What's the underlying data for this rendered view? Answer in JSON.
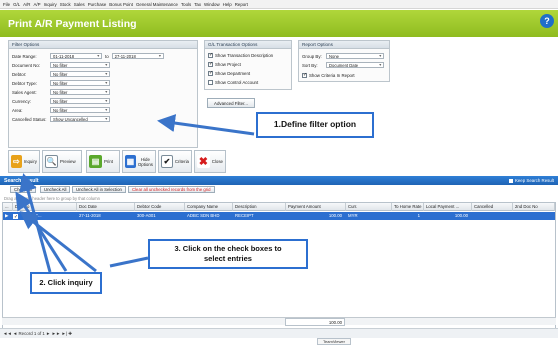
{
  "menubar": [
    "File",
    "G/L",
    "A/R",
    "A/P",
    "Inquiry",
    "Stock",
    "Sales",
    "Purchase",
    "Bonus Point",
    "General Maintenance",
    "Tools",
    "Tax",
    "Window",
    "Help",
    "Report"
  ],
  "page_title": "Print A/R Payment Listing",
  "help_icon": "?",
  "filter_options": {
    "title": "Filter Options",
    "date_range_label": "Date Range:",
    "date_from": "01-11-2018",
    "date_to_label": "to",
    "date_to": "27-11-2018",
    "rows": [
      {
        "label": "Document No:",
        "value": "No filter"
      },
      {
        "label": "Debtor:",
        "value": "No filter"
      },
      {
        "label": "Debtor Type:",
        "value": "No filter"
      },
      {
        "label": "Sales Agent:",
        "value": "No filter"
      },
      {
        "label": "Currency:",
        "value": "No filter"
      },
      {
        "label": "Area:",
        "value": "No filter"
      },
      {
        "label": "Cancelled Status:",
        "value": "Show Uncancelled"
      }
    ]
  },
  "gl_options": {
    "title": "G/L Transaction Options",
    "checks": [
      {
        "label": "Show Transaction Description",
        "checked": true
      },
      {
        "label": "Show Project",
        "checked": true
      },
      {
        "label": "Show Department",
        "checked": true
      },
      {
        "label": "Show Control Account",
        "checked": false
      }
    ],
    "advanced_filter": "Advanced Filter..."
  },
  "report_options": {
    "title": "Report Options",
    "group_by_label": "Group By:",
    "group_by": "None",
    "sort_by_label": "Sort By:",
    "sort_by": "Document Date",
    "show_criteria": "Show Criteria In Report",
    "show_criteria_checked": true
  },
  "toolbar": {
    "inquiry": "Inquiry",
    "preview": "Preview",
    "print": "Print",
    "hide_options_1": "Hide",
    "hide_options_2": "Options",
    "criteria": "Criteria",
    "close": "Close"
  },
  "search_result": {
    "title": "Search Result",
    "keep": "Keep Search Result",
    "check_all": "Check All",
    "uncheck_all": "Uncheck All",
    "uncheck_all_selection": "Uncheck All in Selection",
    "clear_unchecked": "Clear all unchecked records from the grid",
    "group_hint": "Drag a column header here to group by that column"
  },
  "grid": {
    "columns": [
      "...",
      "Doc No",
      "Doc Date",
      "Debtor Code",
      "Company Name",
      "Description",
      "Payment Amount",
      "Curr.",
      "To Home Rate",
      "Local Payment ...",
      "Cancelled",
      "2nd Doc No"
    ],
    "rows": [
      {
        "doc_no": "OR-000...",
        "doc_date": "27-11-2018",
        "debtor_code": "300-A001",
        "company_name": "ADBC SDN BHD",
        "description": "RECEIPT",
        "payment_amount": "100.00",
        "curr": "MYR",
        "to_home_rate": "1",
        "local_payment": "100.00",
        "cancelled": "",
        "second_doc_no": ""
      }
    ],
    "total_amount": "100.00"
  },
  "statusbar": {
    "nav": "◄◄  ◄  Record 1 of 1  ►  ►►  ►|  ✚",
    "teamviewer": "TeamViewer"
  },
  "callouts": {
    "c1": "1.Define filter option",
    "c2": "2. Click inquiry",
    "c3_line1": "3. Click on the check boxes to",
    "c3_line2": "select entries"
  },
  "colors": {
    "title_green": "#9bc62b",
    "search_blue": "#2576cf",
    "callout_border": "#2c6fd0",
    "arrow": "#3a74c9",
    "clear_red": "#d01e1e"
  }
}
